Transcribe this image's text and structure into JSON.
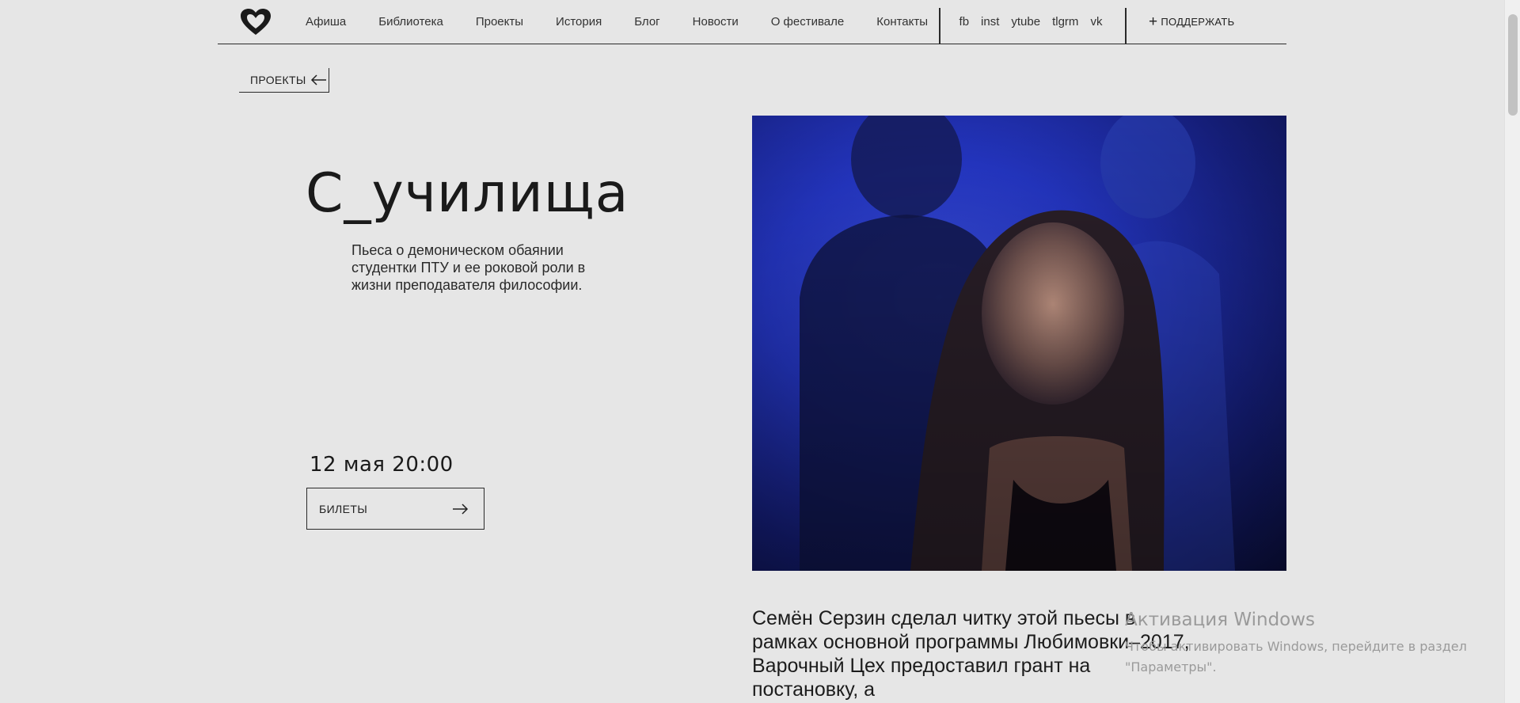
{
  "header": {
    "nav": [
      "Афиша",
      "Библиотека",
      "Проекты",
      "История",
      "Блог",
      "Новости",
      "О фестивале",
      "Контакты"
    ],
    "social": [
      "fb",
      "inst",
      "ytube",
      "tlgrm",
      "vk"
    ],
    "support_label": "ПОДДЕРЖАТЬ"
  },
  "back_label": "ПРОЕКТЫ",
  "project": {
    "title": "С_училища",
    "description": "Пьеса о демоническом обаянии студентки ПТУ и ее роковой роли в жизни преподавателя философии.",
    "date": "12 мая 20:00",
    "tickets_label": "БИЛЕТЫ"
  },
  "article": {
    "text": "Семён Серзин сделал читку этой пьесы в рамках основной программы Любимовки–2017, Варочный Цех предоставил грант на постановку, а"
  },
  "watermark": {
    "title": "Активация Windows",
    "text": "Чтобы активировать Windows, перейдите в раздел \"Параметры\"."
  },
  "colors": {
    "background": "#e6e6e6",
    "text": "#1f1f1f",
    "photo_blue": "#2436c4"
  }
}
